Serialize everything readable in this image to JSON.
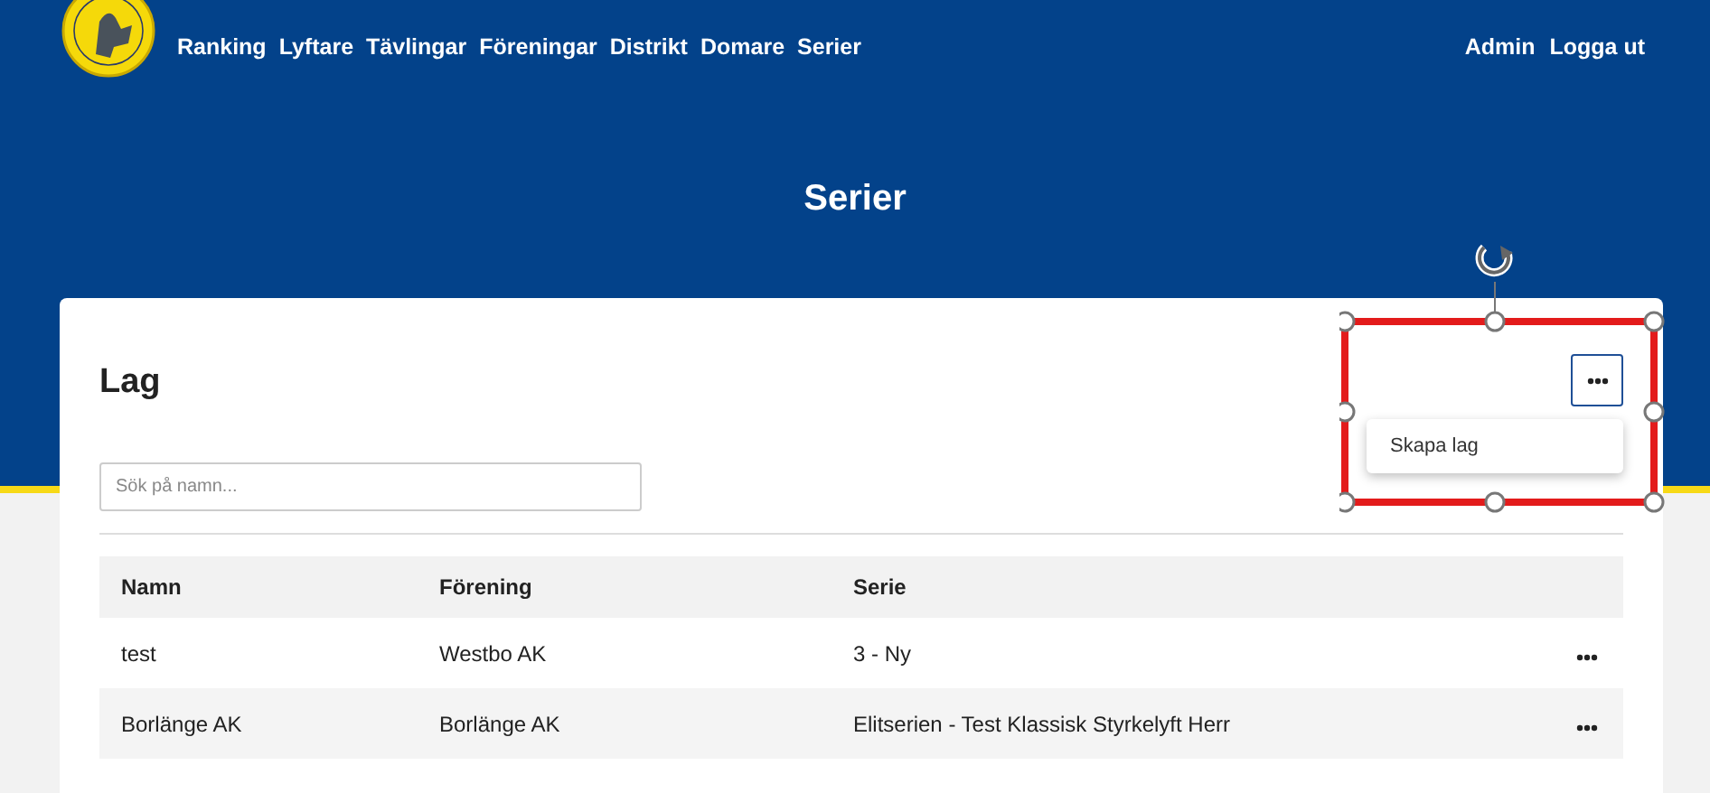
{
  "nav": {
    "items": [
      {
        "label": "Ranking"
      },
      {
        "label": "Lyftare"
      },
      {
        "label": "Tävlingar"
      },
      {
        "label": "Föreningar"
      },
      {
        "label": "Distrikt"
      },
      {
        "label": "Domare"
      },
      {
        "label": "Serier"
      }
    ],
    "user_links": [
      {
        "label": "Admin"
      },
      {
        "label": "Logga ut"
      }
    ]
  },
  "page_title": "Serier",
  "card": {
    "title": "Lag",
    "search": {
      "placeholder": "Sök på namn..."
    },
    "menu": {
      "expanded": true,
      "items": [
        {
          "label": "Skapa lag"
        }
      ]
    },
    "table": {
      "columns": [
        "Namn",
        "Förening",
        "Serie"
      ],
      "rows": [
        {
          "cells": [
            "test",
            "Westbo AK",
            "3 - Ny"
          ]
        },
        {
          "cells": [
            "Borlänge AK",
            "Borlänge AK",
            "Elitserien - Test Klassisk Styrkelyft Herr"
          ]
        }
      ]
    }
  }
}
